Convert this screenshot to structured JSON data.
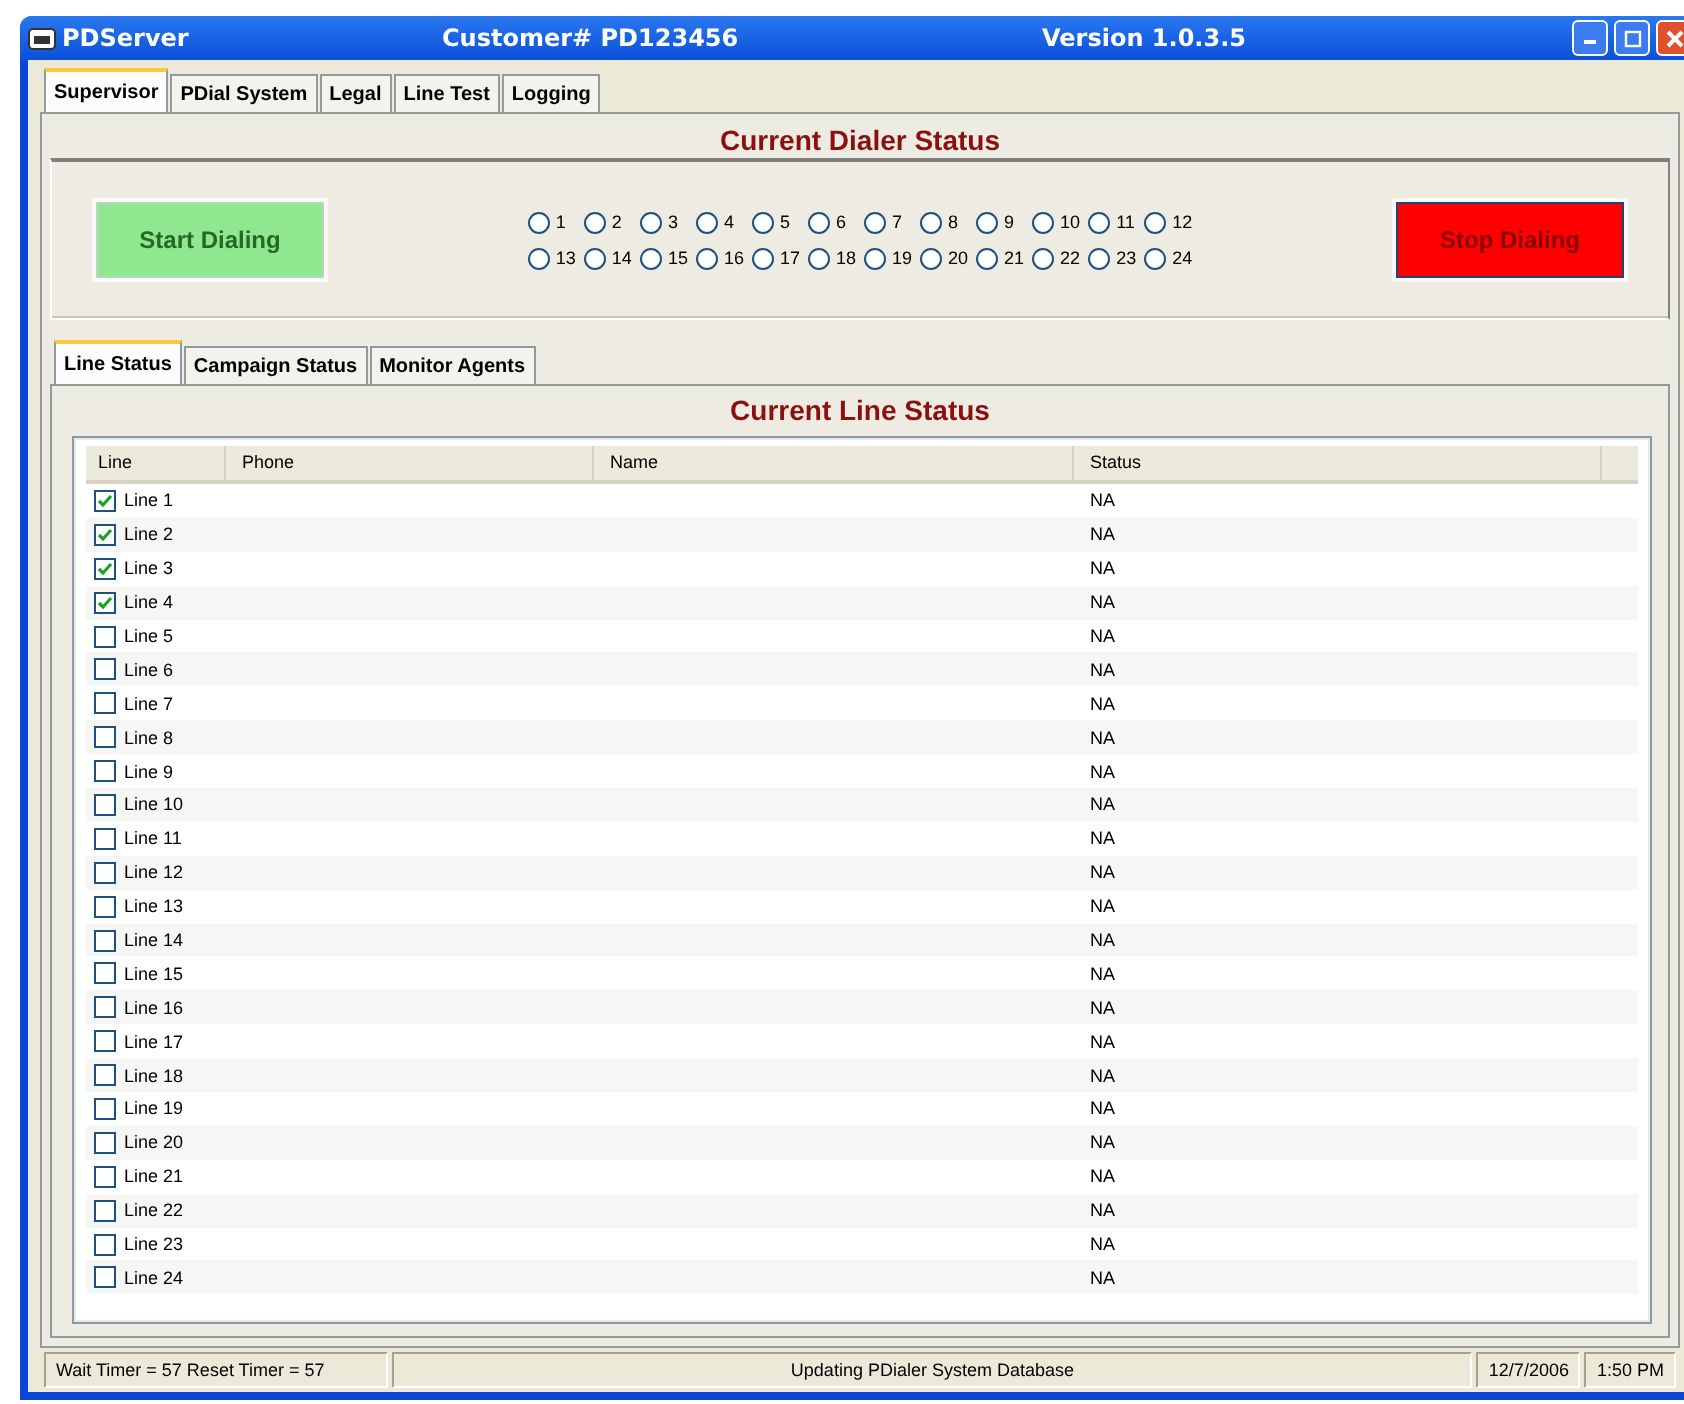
{
  "window": {
    "title": "PDServer",
    "customer": "Customer# PD123456",
    "version": "Version 1.0.3.5"
  },
  "tabs": [
    {
      "label": "Supervisor",
      "selected": true
    },
    {
      "label": "PDial System",
      "selected": false
    },
    {
      "label": "Legal",
      "selected": false
    },
    {
      "label": "Line Test",
      "selected": false
    },
    {
      "label": "Logging",
      "selected": false
    }
  ],
  "dialer": {
    "title": "Current Dialer Status",
    "start_button": "Start Dialing",
    "stop_button": "Stop Dialing",
    "lines": [
      {
        "label": "1",
        "selected": false
      },
      {
        "label": "2",
        "selected": false
      },
      {
        "label": "3",
        "selected": false
      },
      {
        "label": "4",
        "selected": false
      },
      {
        "label": "5",
        "selected": false
      },
      {
        "label": "6",
        "selected": false
      },
      {
        "label": "7",
        "selected": false
      },
      {
        "label": "8",
        "selected": false
      },
      {
        "label": "9",
        "selected": false
      },
      {
        "label": "10",
        "selected": false
      },
      {
        "label": "11",
        "selected": false
      },
      {
        "label": "12",
        "selected": false
      },
      {
        "label": "13",
        "selected": false
      },
      {
        "label": "14",
        "selected": false
      },
      {
        "label": "15",
        "selected": false
      },
      {
        "label": "16",
        "selected": false
      },
      {
        "label": "17",
        "selected": false
      },
      {
        "label": "18",
        "selected": false
      },
      {
        "label": "19",
        "selected": false
      },
      {
        "label": "20",
        "selected": false
      },
      {
        "label": "21",
        "selected": false
      },
      {
        "label": "22",
        "selected": false
      },
      {
        "label": "23",
        "selected": false
      },
      {
        "label": "24",
        "selected": false
      }
    ]
  },
  "sub_tabs": [
    {
      "label": "Line Status",
      "selected": true
    },
    {
      "label": "Campaign Status",
      "selected": false
    },
    {
      "label": "Monitor Agents",
      "selected": false
    }
  ],
  "line_status": {
    "title": "Current Line Status",
    "columns": [
      "Line",
      "Phone",
      "Name",
      "Status"
    ],
    "rows": [
      {
        "line": "Line 1",
        "checked": true,
        "phone": "",
        "name": "",
        "status": "NA"
      },
      {
        "line": "Line 2",
        "checked": true,
        "status": "NA"
      },
      {
        "line": "Line 3",
        "checked": true,
        "status": "NA"
      },
      {
        "line": "Line 4",
        "checked": true,
        "status": "NA"
      },
      {
        "line": "Line 5",
        "checked": false,
        "status": "NA"
      },
      {
        "line": "Line 6",
        "checked": false,
        "status": "NA"
      },
      {
        "line": "Line 7",
        "checked": false,
        "status": "NA"
      },
      {
        "line": "Line 8",
        "checked": false,
        "status": "NA"
      },
      {
        "line": "Line 9",
        "checked": false,
        "status": "NA"
      },
      {
        "line": "Line 10",
        "checked": false,
        "status": "NA"
      },
      {
        "line": "Line 11",
        "checked": false,
        "status": "NA"
      },
      {
        "line": "Line 12",
        "checked": false,
        "status": "NA"
      },
      {
        "line": "Line 13",
        "checked": false,
        "status": "NA"
      },
      {
        "line": "Line 14",
        "checked": false,
        "status": "NA"
      },
      {
        "line": "Line 15",
        "checked": false,
        "status": "NA"
      },
      {
        "line": "Line 16",
        "checked": false,
        "status": "NA"
      },
      {
        "line": "Line 17",
        "checked": false,
        "status": "NA"
      },
      {
        "line": "Line 18",
        "checked": false,
        "status": "NA"
      },
      {
        "line": "Line 19",
        "checked": false,
        "status": "NA"
      },
      {
        "line": "Line 20",
        "checked": false,
        "status": "NA"
      },
      {
        "line": "Line 21",
        "checked": false,
        "status": "NA"
      },
      {
        "line": "Line 22",
        "checked": false,
        "status": "NA"
      },
      {
        "line": "Line 23",
        "checked": false,
        "status": "NA"
      },
      {
        "line": "Line 24",
        "checked": false,
        "status": "NA"
      }
    ]
  },
  "status_bar": {
    "timers": "Wait Timer = 57  Reset Timer = 57",
    "message": "Updating PDialer System Database",
    "date": "12/7/2006",
    "time": "1:50 PM"
  }
}
